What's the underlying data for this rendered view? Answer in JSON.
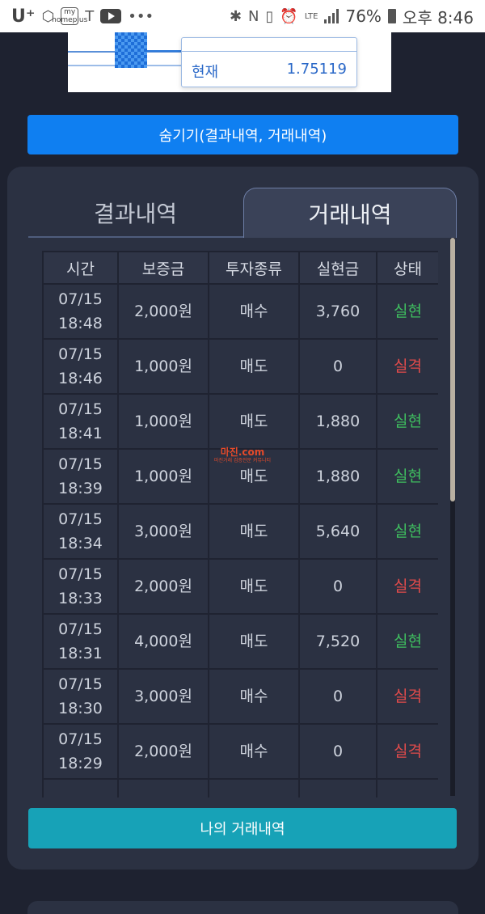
{
  "status_bar": {
    "carrier": "U⁺",
    "app_badge": "my\nhomeplus",
    "tmap": "T",
    "battery": "76%",
    "time": "오후 8:46",
    "network": "LTE"
  },
  "chart_tooltip": {
    "label": "현재",
    "value": "1.75119"
  },
  "hide_button": "숨기기(결과내역, 거래내역)",
  "tabs": {
    "results": "결과내역",
    "trades": "거래내역"
  },
  "table": {
    "headers": [
      "시간",
      "보증금",
      "투자종류",
      "실현금",
      "상태"
    ],
    "rows": [
      {
        "date": "07/15",
        "time": "18:48",
        "deposit": "2,000원",
        "type": "매수",
        "realized": "3,760",
        "status": "실현"
      },
      {
        "date": "07/15",
        "time": "18:46",
        "deposit": "1,000원",
        "type": "매도",
        "realized": "0",
        "status": "실격"
      },
      {
        "date": "07/15",
        "time": "18:41",
        "deposit": "1,000원",
        "type": "매도",
        "realized": "1,880",
        "status": "실현"
      },
      {
        "date": "07/15",
        "time": "18:39",
        "deposit": "1,000원",
        "type": "매도",
        "realized": "1,880",
        "status": "실현"
      },
      {
        "date": "07/15",
        "time": "18:34",
        "deposit": "3,000원",
        "type": "매도",
        "realized": "5,640",
        "status": "실현"
      },
      {
        "date": "07/15",
        "time": "18:33",
        "deposit": "2,000원",
        "type": "매도",
        "realized": "0",
        "status": "실격"
      },
      {
        "date": "07/15",
        "time": "18:31",
        "deposit": "4,000원",
        "type": "매도",
        "realized": "7,520",
        "status": "실현"
      },
      {
        "date": "07/15",
        "time": "18:30",
        "deposit": "3,000원",
        "type": "매수",
        "realized": "0",
        "status": "실격"
      },
      {
        "date": "07/15",
        "time": "18:29",
        "deposit": "2,000원",
        "type": "매수",
        "realized": "0",
        "status": "실격"
      },
      {
        "date": "07/15",
        "time": "",
        "deposit": "",
        "type": "",
        "realized": "",
        "status": ""
      }
    ]
  },
  "my_trades_button": "나의 거래내역",
  "watermark": {
    "main": "마진.com",
    "sub": "마진거래 검증전문 커뮤니티"
  },
  "colors": {
    "success": "#3fbf5f",
    "fail": "#e24b4b",
    "primary_button": "#0f7ff1",
    "teal_button": "#17a2b7"
  }
}
